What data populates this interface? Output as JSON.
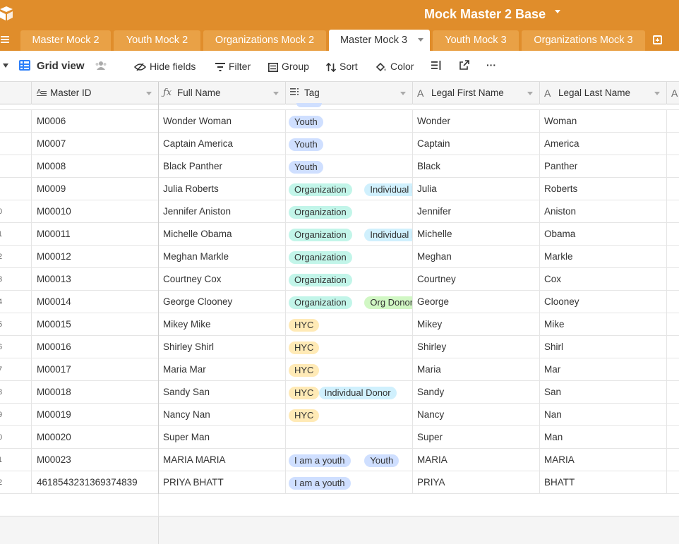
{
  "app": {
    "base_title": "Mock Master 2 Base"
  },
  "tabs": [
    {
      "label": "Master Mock 2",
      "active": false
    },
    {
      "label": "Youth Mock 2",
      "active": false
    },
    {
      "label": "Organizations Mock 2",
      "active": false
    },
    {
      "label": "Master Mock 3",
      "active": true
    },
    {
      "label": "Youth Mock 3",
      "active": false
    },
    {
      "label": "Organizations Mock 3",
      "active": false
    }
  ],
  "toolbar": {
    "view_name": "Grid view",
    "hide_fields": "Hide fields",
    "filter": "Filter",
    "group": "Group",
    "sort": "Sort",
    "color": "Color",
    "more": "···"
  },
  "columns": [
    {
      "name": "Master ID",
      "type_icon": "long-text-icon"
    },
    {
      "name": "Full Name",
      "type_icon": "formula-icon"
    },
    {
      "name": "Tag",
      "type_icon": "multi-select-icon"
    },
    {
      "name": "Legal First Name",
      "type_icon": "text-icon"
    },
    {
      "name": "Legal Last Name",
      "type_icon": "text-icon"
    }
  ],
  "tag_colors": {
    "Youth": "#cfdfff",
    "Organization": "#c2f5e9",
    "Individual Donor": "#d0f0fd",
    "Org Donor": "#d1f7c4",
    "HYC": "#ffeab6",
    "I am a youth": "#cfdfff"
  },
  "rows": [
    {
      "num": "",
      "id": "M0006",
      "full": "Wonder Woman",
      "tags": [
        "Youth"
      ],
      "first": "Wonder",
      "last": "Woman"
    },
    {
      "num": "",
      "id": "M0007",
      "full": "Captain America",
      "tags": [
        "Youth"
      ],
      "first": "Captain",
      "last": "America"
    },
    {
      "num": "",
      "id": "M0008",
      "full": "Black Panther",
      "tags": [
        "Youth"
      ],
      "first": "Black",
      "last": "Panther"
    },
    {
      "num": "",
      "id": "M0009",
      "full": "Julia Roberts",
      "tags": [
        "Organization",
        "Individual Donor"
      ],
      "first": "Julia",
      "last": "Roberts"
    },
    {
      "num": "0",
      "id": "M00010",
      "full": "Jennifer Aniston",
      "tags": [
        "Organization"
      ],
      "first": "Jennifer",
      "last": "Aniston"
    },
    {
      "num": "1",
      "id": "M00011",
      "full": "Michelle Obama",
      "tags": [
        "Organization",
        "Individual Donor"
      ],
      "first": "Michelle",
      "last": "Obama"
    },
    {
      "num": "2",
      "id": "M00012",
      "full": "Meghan Markle",
      "tags": [
        "Organization"
      ],
      "first": "Meghan",
      "last": "Markle"
    },
    {
      "num": "3",
      "id": "M00013",
      "full": "Courtney Cox",
      "tags": [
        "Organization"
      ],
      "first": "Courtney",
      "last": "Cox"
    },
    {
      "num": "4",
      "id": "M00014",
      "full": "George Clooney",
      "tags": [
        "Organization",
        "Org Donor"
      ],
      "first": "George",
      "last": "Clooney"
    },
    {
      "num": "5",
      "id": "M00015",
      "full": "Mikey Mike",
      "tags": [
        "HYC"
      ],
      "first": "Mikey",
      "last": "Mike"
    },
    {
      "num": "6",
      "id": "M00016",
      "full": "Shirley Shirl",
      "tags": [
        "HYC"
      ],
      "first": "Shirley",
      "last": "Shirl"
    },
    {
      "num": "7",
      "id": "M00017",
      "full": "Maria Mar",
      "tags": [
        "HYC"
      ],
      "first": "Maria",
      "last": "Mar"
    },
    {
      "num": "8",
      "id": "M00018",
      "full": "Sandy San",
      "tags": [
        "HYC",
        "Individual Donor"
      ],
      "first": "Sandy",
      "last": "San"
    },
    {
      "num": "9",
      "id": "M00019",
      "full": "Nancy Nan",
      "tags": [
        "HYC"
      ],
      "first": "Nancy",
      "last": "Nan"
    },
    {
      "num": "0",
      "id": "M00020",
      "full": "Super Man",
      "tags": [],
      "first": "Super",
      "last": "Man"
    },
    {
      "num": "1",
      "id": "M00023",
      "full": "MARIA MARIA",
      "tags": [
        "I am a youth",
        "Youth"
      ],
      "first": "MARIA",
      "last": "MARIA"
    },
    {
      "num": "2",
      "id": "4618543231369374839",
      "full": "PRIYA BHATT",
      "tags": [
        "I am a youth"
      ],
      "first": "PRIYA",
      "last": "BHATT"
    }
  ]
}
